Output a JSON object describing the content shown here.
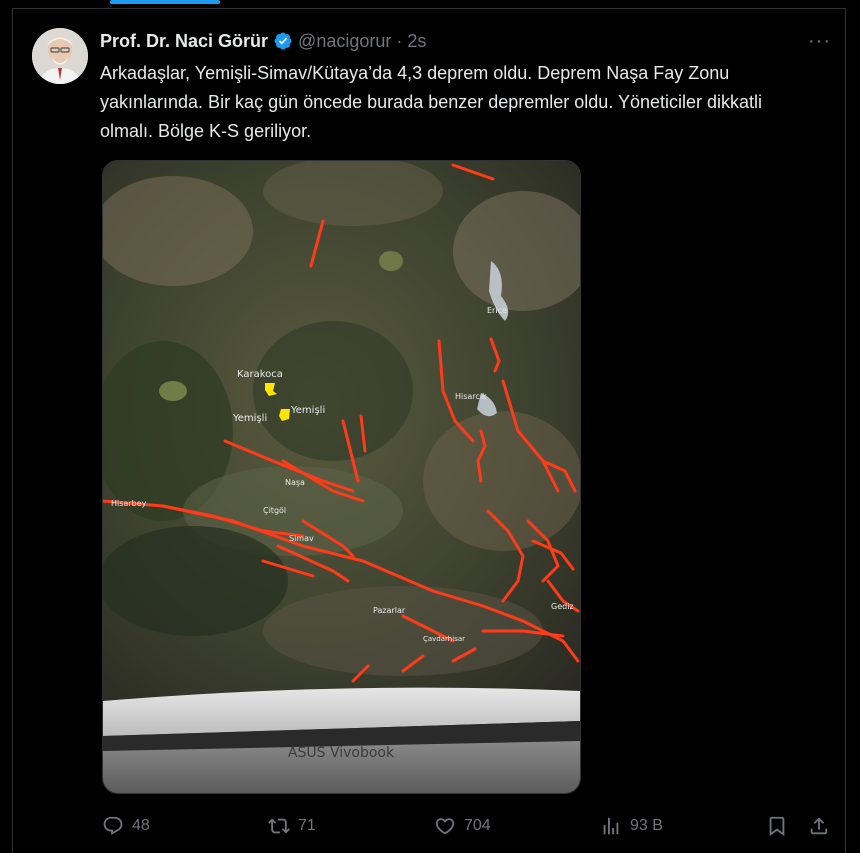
{
  "tweet": {
    "author_name": "Prof. Dr. Naci Görür",
    "handle": "@nacigorur",
    "separator": "·",
    "time": "2s",
    "more_label": "···",
    "text": "Arkadaşlar, Yemişli-Simav/Kütaya’da 4,3 deprem oldu. Deprem Naşa Fay Zonu yakınlarında. Bir kaç gün öncede burada benzer depremler oldu. Yöneticiler dikkatli olmalı. Bölge K-S geriliyor."
  },
  "media": {
    "map_labels": {
      "karakoca": "Karakoca",
      "yemisli_left": "Yemişli",
      "yemisli_right": "Yemişli",
      "nasa": "Naşa",
      "hisarbey": "Hisarbey",
      "citgol": "Çitgöl",
      "simav": "Simav",
      "pazarlar": "Pazarlar",
      "erice": "Erice",
      "hisarcik": "Hisarcık",
      "gediz": "Gediz",
      "cavdarhisar": "Çavdarhisar"
    },
    "laptop_brand": "ASUS Vivobook",
    "fault_color": "#ff3b1a",
    "marker_color": "#ffe600"
  },
  "actions": {
    "reply": {
      "icon": "reply-icon",
      "count": "48"
    },
    "retweet": {
      "icon": "retweet-icon",
      "count": "71"
    },
    "like": {
      "icon": "heart-icon",
      "count": "704"
    },
    "views": {
      "icon": "views-icon",
      "count": "93 B"
    },
    "bookmark": {
      "icon": "bookmark-icon"
    },
    "share": {
      "icon": "share-icon"
    }
  },
  "colors": {
    "accent": "#1d9bf0",
    "text": "#e7e9ea",
    "muted": "#71767b"
  }
}
